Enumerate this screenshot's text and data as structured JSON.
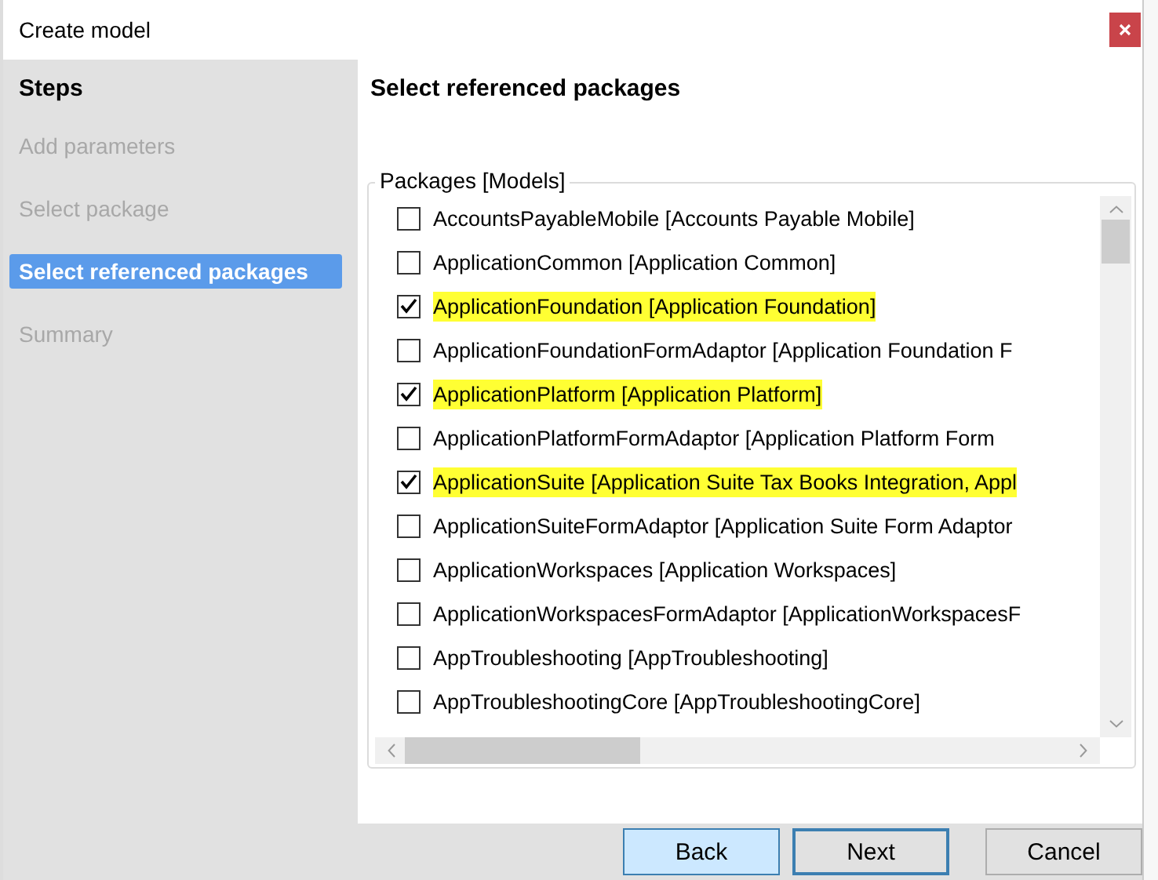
{
  "window": {
    "title": "Create model"
  },
  "steps": {
    "title": "Steps",
    "items": [
      {
        "label": "Add parameters",
        "selected": false,
        "disabled": true
      },
      {
        "label": "Select package",
        "selected": false,
        "disabled": true
      },
      {
        "label": "Select referenced packages",
        "selected": true,
        "disabled": false
      },
      {
        "label": "Summary",
        "selected": false,
        "disabled": true
      }
    ]
  },
  "page": {
    "title": "Select referenced packages",
    "group_label": "Packages [Models]",
    "packages": [
      {
        "label": "AccountsPayableMobile [Accounts Payable Mobile]",
        "checked": false,
        "highlighted": false
      },
      {
        "label": "ApplicationCommon [Application Common]",
        "checked": false,
        "highlighted": false
      },
      {
        "label": "ApplicationFoundation [Application Foundation]",
        "checked": true,
        "highlighted": true
      },
      {
        "label": "ApplicationFoundationFormAdaptor [Application Foundation F",
        "checked": false,
        "highlighted": false
      },
      {
        "label": "ApplicationPlatform [Application Platform]",
        "checked": true,
        "highlighted": true
      },
      {
        "label": "ApplicationPlatformFormAdaptor [Application Platform Form",
        "checked": false,
        "highlighted": false
      },
      {
        "label": "ApplicationSuite [Application Suite Tax Books Integration, Appl",
        "checked": true,
        "highlighted": true
      },
      {
        "label": "ApplicationSuiteFormAdaptor [Application Suite Form Adaptor",
        "checked": false,
        "highlighted": false
      },
      {
        "label": "ApplicationWorkspaces [Application Workspaces]",
        "checked": false,
        "highlighted": false
      },
      {
        "label": "ApplicationWorkspacesFormAdaptor [ApplicationWorkspacesF",
        "checked": false,
        "highlighted": false
      },
      {
        "label": "AppTroubleshooting [AppTroubleshooting]",
        "checked": false,
        "highlighted": false
      },
      {
        "label": "AppTroubleshootingCore [AppTroubleshootingCore]",
        "checked": false,
        "highlighted": false
      }
    ]
  },
  "buttons": [
    {
      "label": "Back",
      "kind": "focused"
    },
    {
      "label": "Next",
      "kind": "default"
    },
    {
      "label": "Cancel",
      "kind": "normal"
    }
  ]
}
